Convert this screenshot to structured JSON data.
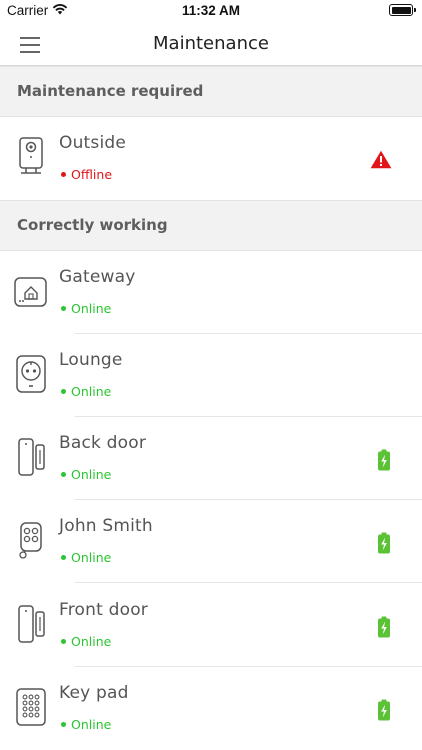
{
  "status_bar": {
    "carrier": "Carrier",
    "time": "11:32 AM"
  },
  "nav": {
    "title": "Maintenance",
    "menu_icon": "hamburger-menu-icon"
  },
  "colors": {
    "online": "#2bc531",
    "offline": "#e0161b",
    "warning": "#e0161b",
    "battery": "#5bc236"
  },
  "sections": {
    "maintenance_required": {
      "label": "Maintenance required",
      "devices": [
        {
          "name": "Outside",
          "status": "Offline",
          "icon": "camera-icon",
          "indicator": "warning-icon"
        }
      ]
    },
    "correctly_working": {
      "label": "Correctly working",
      "devices": [
        {
          "name": "Gateway",
          "status": "Online",
          "icon": "gateway-icon",
          "indicator": ""
        },
        {
          "name": "Lounge",
          "status": "Online",
          "icon": "smart-plug-icon",
          "indicator": ""
        },
        {
          "name": "Back door",
          "status": "Online",
          "icon": "door-sensor-icon",
          "indicator": "battery-charging-icon"
        },
        {
          "name": "John Smith",
          "status": "Online",
          "icon": "key-fob-icon",
          "indicator": "battery-charging-icon"
        },
        {
          "name": "Front door",
          "status": "Online",
          "icon": "door-sensor-icon",
          "indicator": "battery-charging-icon"
        },
        {
          "name": "Key pad",
          "status": "Online",
          "icon": "keypad-icon",
          "indicator": "battery-charging-icon"
        }
      ]
    }
  }
}
